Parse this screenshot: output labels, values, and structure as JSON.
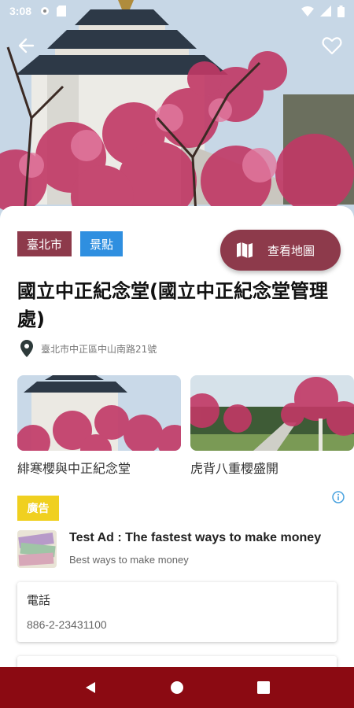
{
  "status_bar": {
    "time": "3:08",
    "icons_left": [
      "gear-icon",
      "sd-card-icon"
    ],
    "icons_right": [
      "wifi-icon",
      "signal-icon",
      "battery-icon"
    ]
  },
  "header": {
    "back_icon": "arrow-left-icon",
    "favorite_icon": "heart-outline-icon"
  },
  "tags": {
    "city": "臺北市",
    "type": "景點"
  },
  "map_button": {
    "label": "查看地圖",
    "icon": "map-icon"
  },
  "title": "國立中正紀念堂(國立中正紀念堂管理處)",
  "address": "臺北市中正區中山南路21號",
  "photos": [
    {
      "caption": "緋寒櫻與中正紀念堂"
    },
    {
      "caption": "虎背八重櫻盛開"
    }
  ],
  "ad": {
    "label": "廣告",
    "title": "Test Ad : The fastest ways to make money",
    "subtitle": "Best ways to make money"
  },
  "phone": {
    "label": "電話",
    "value": "886-2-23431100"
  },
  "colors": {
    "accent": "#8d3a4b",
    "tag_blue": "#2f8fe0",
    "ad_yellow": "#f0d020",
    "nav_bar": "#8b0a12"
  }
}
